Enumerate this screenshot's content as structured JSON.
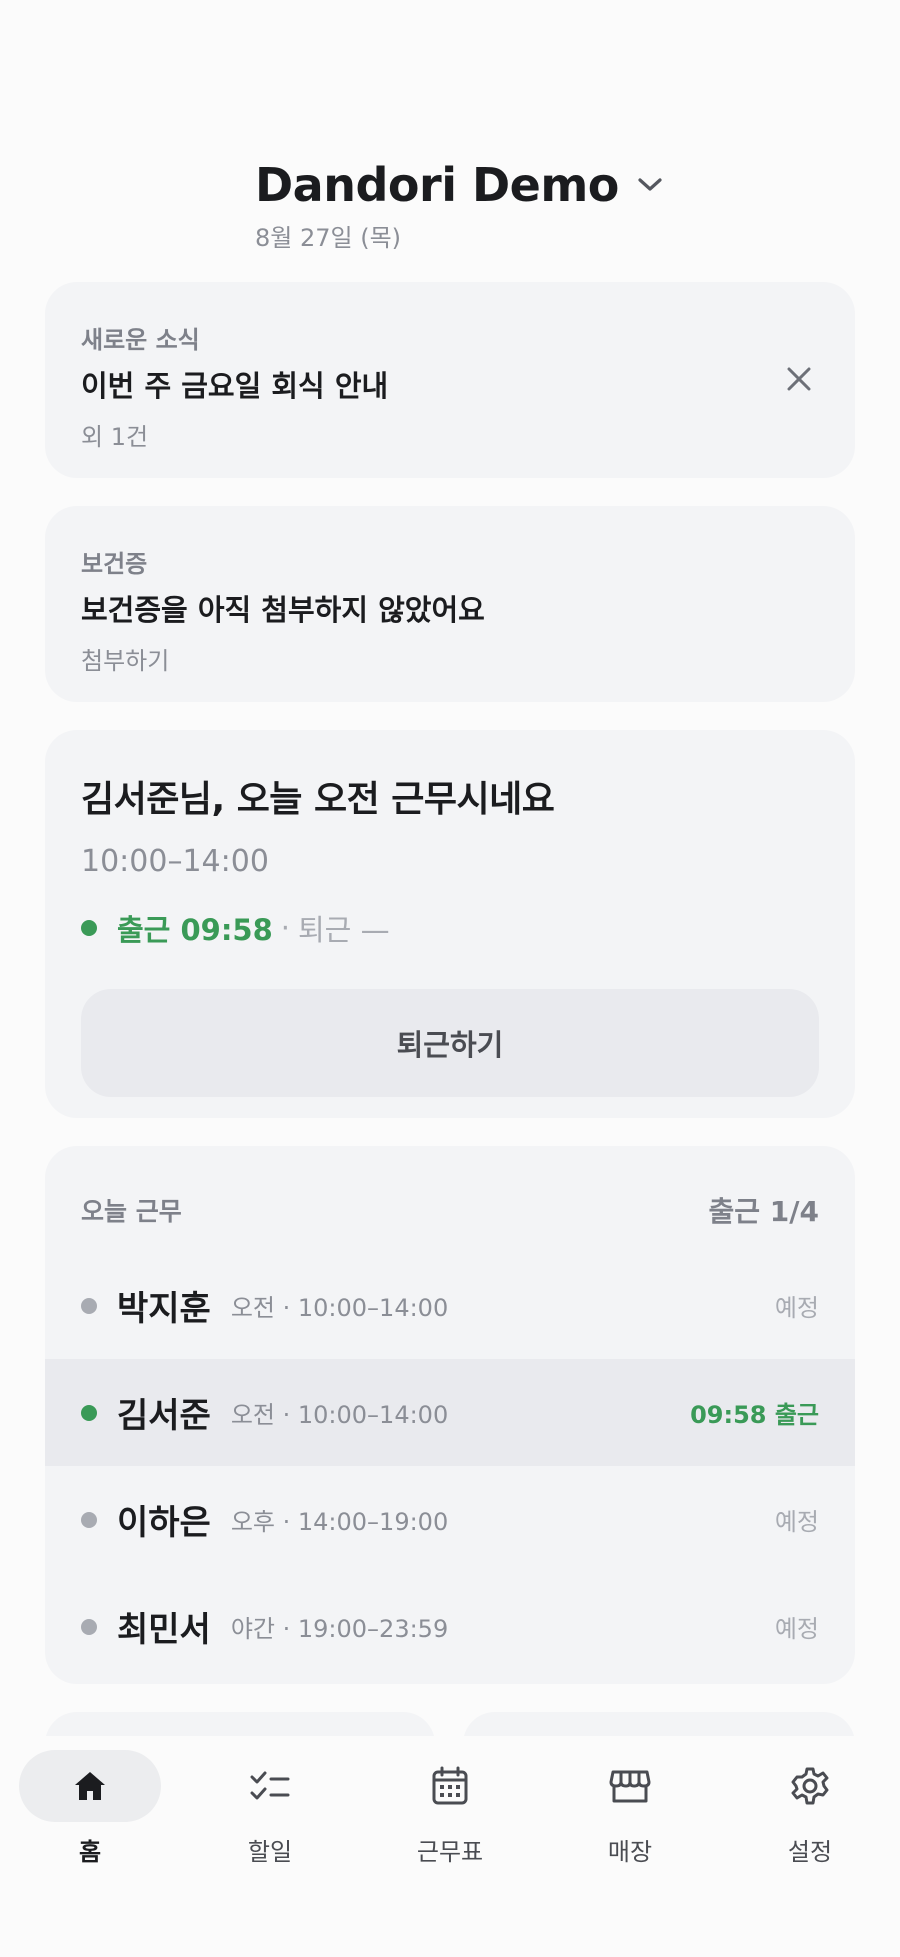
{
  "header": {
    "store_name": "Dandori Demo",
    "date": "8월 27일 (목)"
  },
  "news_card": {
    "label": "새로운 소식",
    "title": "이번 주 금요일 회식 안내",
    "sub": "외 1건"
  },
  "health_card": {
    "label": "보건증",
    "title": "보건증을 아직 첨부하지 않았어요",
    "action": "첨부하기"
  },
  "shift_card": {
    "greeting": "김서준님, 오늘 오전 근무시네요",
    "time": "10:00–14:00",
    "clock_in": "출근 09:58",
    "separator": "·",
    "clock_out": "퇴근 —",
    "button": "퇴근하기"
  },
  "today": {
    "label": "오늘 근무",
    "count": "출근 1/4",
    "rows": [
      {
        "name": "박지훈",
        "meta": "오전 · 10:00–14:00",
        "state": "예정",
        "status": "scheduled"
      },
      {
        "name": "김서준",
        "meta": "오전 · 10:00–14:00",
        "state": "09:58 출근",
        "status": "in"
      },
      {
        "name": "이하은",
        "meta": "오후 · 14:00–19:00",
        "state": "예정",
        "status": "scheduled"
      },
      {
        "name": "최민서",
        "meta": "야간 · 19:00–23:59",
        "state": "예정",
        "status": "scheduled"
      }
    ]
  },
  "nav": {
    "items": [
      {
        "label": "홈",
        "icon": "home-icon",
        "active": true
      },
      {
        "label": "할일",
        "icon": "checklist-icon",
        "active": false
      },
      {
        "label": "근무표",
        "icon": "calendar-icon",
        "active": false
      },
      {
        "label": "매장",
        "icon": "store-icon",
        "active": false
      },
      {
        "label": "설정",
        "icon": "gear-icon",
        "active": false
      }
    ]
  },
  "colors": {
    "accent_green": "#3a9a57",
    "card_bg": "#f3f4f6",
    "muted": "#8b8e96"
  }
}
